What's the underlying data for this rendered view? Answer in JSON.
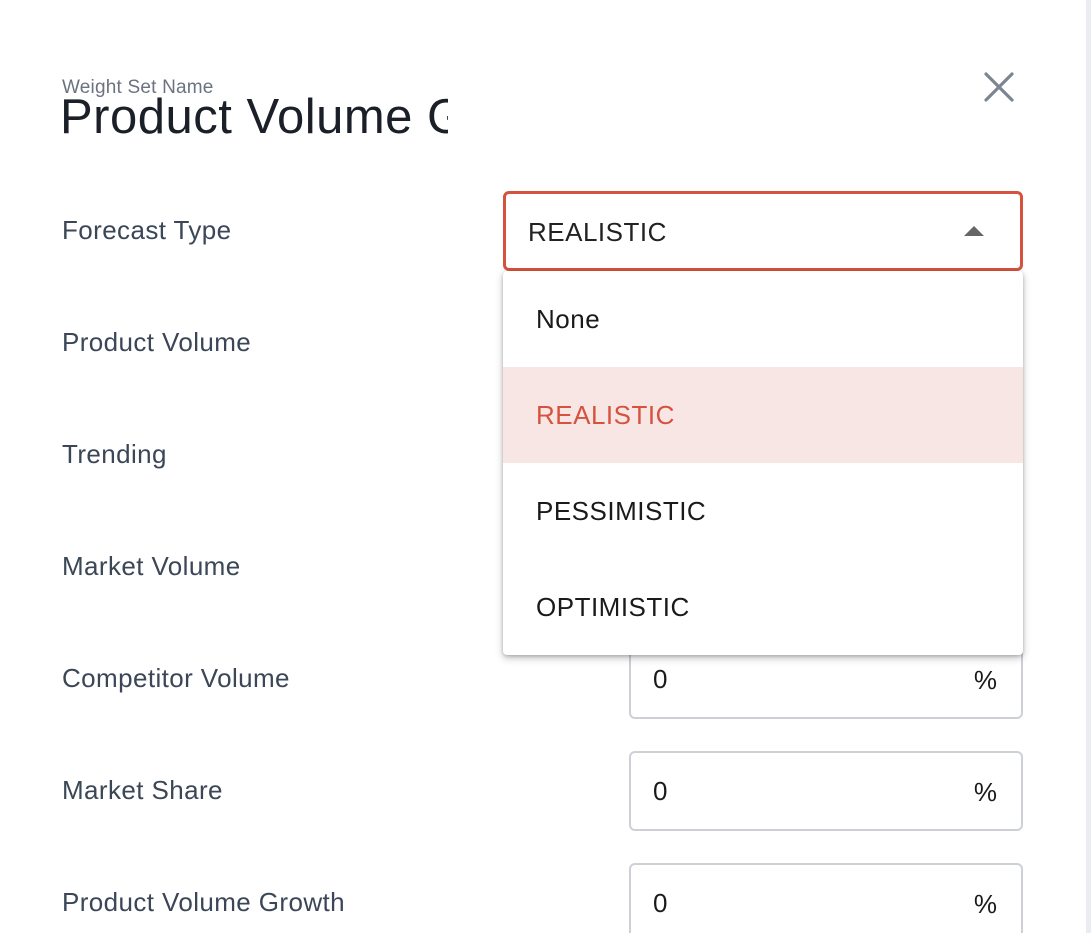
{
  "dialog": {
    "name_caption": "Weight Set Name",
    "name_value": "Product Volume Growth Weights"
  },
  "form": {
    "forecast_type": {
      "label": "Forecast Type",
      "selected": "REALISTIC",
      "options": [
        "None",
        "REALISTIC",
        "PESSIMISTIC",
        "OPTIMISTIC"
      ]
    },
    "rows": [
      {
        "label": "Product Volume"
      },
      {
        "label": "Trending"
      },
      {
        "label": "Market Volume"
      },
      {
        "label": "Competitor Volume",
        "value": "0",
        "suffix": "%"
      },
      {
        "label": "Market Share",
        "value": "0",
        "suffix": "%"
      },
      {
        "label": "Product Volume Growth",
        "value": "0",
        "suffix": "%"
      }
    ]
  },
  "icons": {
    "close": "close-icon",
    "dropdown": "caret-up-icon"
  },
  "colors": {
    "accent": "#d5533e",
    "selected_bg": "#f8e6e4",
    "label": "#3b4657",
    "border": "#cdd1d7"
  }
}
